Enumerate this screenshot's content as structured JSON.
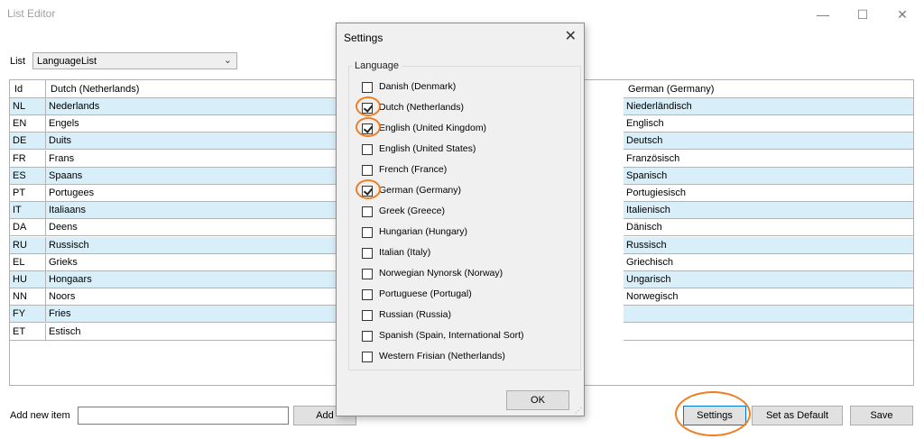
{
  "window": {
    "title": "List Editor",
    "controls": {
      "minimize": "—",
      "maximize": "☐",
      "close": "✕"
    }
  },
  "list_selector": {
    "label": "List",
    "value": "LanguageList"
  },
  "grid": {
    "headers": {
      "id": "Id",
      "dutch": "Dutch (Netherlands)",
      "german": "German (Germany)"
    },
    "rows": [
      {
        "id": "NL",
        "dutch": "Nederlands",
        "german": "Niederländisch"
      },
      {
        "id": "EN",
        "dutch": "Engels",
        "german": "Englisch"
      },
      {
        "id": "DE",
        "dutch": "Duits",
        "german": "Deutsch"
      },
      {
        "id": "FR",
        "dutch": "Frans",
        "german": "Französisch"
      },
      {
        "id": "ES",
        "dutch": "Spaans",
        "german": "Spanisch"
      },
      {
        "id": "PT",
        "dutch": "Portugees",
        "german": "Portugiesisch"
      },
      {
        "id": "IT",
        "dutch": "Italiaans",
        "german": "Italienisch"
      },
      {
        "id": "DA",
        "dutch": "Deens",
        "german": "Dänisch"
      },
      {
        "id": "RU",
        "dutch": "Russisch",
        "german": "Russisch"
      },
      {
        "id": "EL",
        "dutch": "Grieks",
        "german": "Griechisch"
      },
      {
        "id": "HU",
        "dutch": "Hongaars",
        "german": "Ungarisch"
      },
      {
        "id": "NN",
        "dutch": "Noors",
        "german": "Norwegisch"
      },
      {
        "id": "FY",
        "dutch": "Fries",
        "german": ""
      },
      {
        "id": "ET",
        "dutch": "Estisch",
        "german": ""
      }
    ]
  },
  "add_item": {
    "label": "Add new item",
    "value": "",
    "button": "Add"
  },
  "buttons": {
    "settings": "Settings",
    "set_default": "Set as Default",
    "save": "Save"
  },
  "highlight_color": "#f07d22",
  "settings_dialog": {
    "title": "Settings",
    "close": "✕",
    "group_label": "Language",
    "ok": "OK",
    "languages": [
      {
        "label": "Danish (Denmark)",
        "checked": false
      },
      {
        "label": "Dutch (Netherlands)",
        "checked": true
      },
      {
        "label": "English (United Kingdom)",
        "checked": true
      },
      {
        "label": "English (United States)",
        "checked": false
      },
      {
        "label": "French (France)",
        "checked": false
      },
      {
        "label": "German (Germany)",
        "checked": true
      },
      {
        "label": "Greek (Greece)",
        "checked": false
      },
      {
        "label": "Hungarian (Hungary)",
        "checked": false
      },
      {
        "label": "Italian (Italy)",
        "checked": false
      },
      {
        "label": "Norwegian Nynorsk (Norway)",
        "checked": false
      },
      {
        "label": "Portuguese (Portugal)",
        "checked": false
      },
      {
        "label": "Russian (Russia)",
        "checked": false
      },
      {
        "label": "Spanish (Spain, International Sort)",
        "checked": false
      },
      {
        "label": "Western Frisian (Netherlands)",
        "checked": false
      }
    ]
  }
}
